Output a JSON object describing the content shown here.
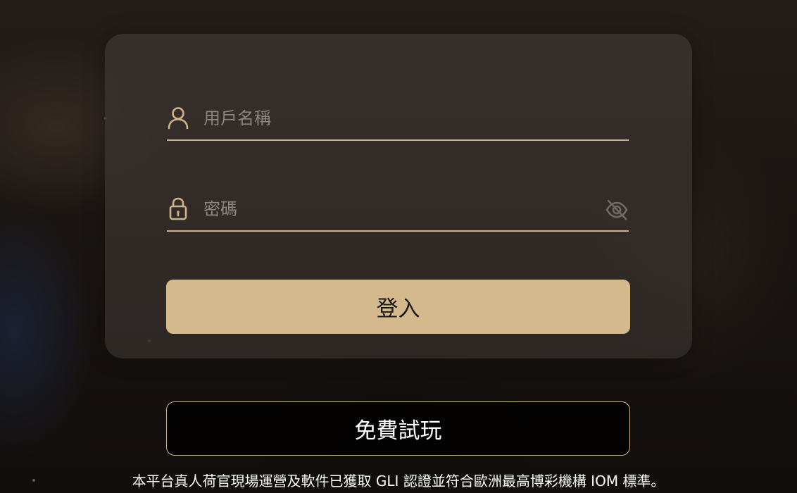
{
  "login_form": {
    "username": {
      "value": "",
      "placeholder": "用戶名稱",
      "icon": "user-icon"
    },
    "password": {
      "value": "",
      "placeholder": "密碼",
      "icon": "lock-icon",
      "visibility_icon": "eye-off-icon"
    },
    "login_label": "登入"
  },
  "trial_label": "免費試玩",
  "disclaimer": "本平台真人荷官現場運營及軟件已獲取 GLI 認證並符合歐洲最高博彩機構 IOM 標準。",
  "colors": {
    "accent": "#d4b98d",
    "underline": "#cdb488",
    "card": "#3a332f",
    "background": "#1b1613"
  }
}
